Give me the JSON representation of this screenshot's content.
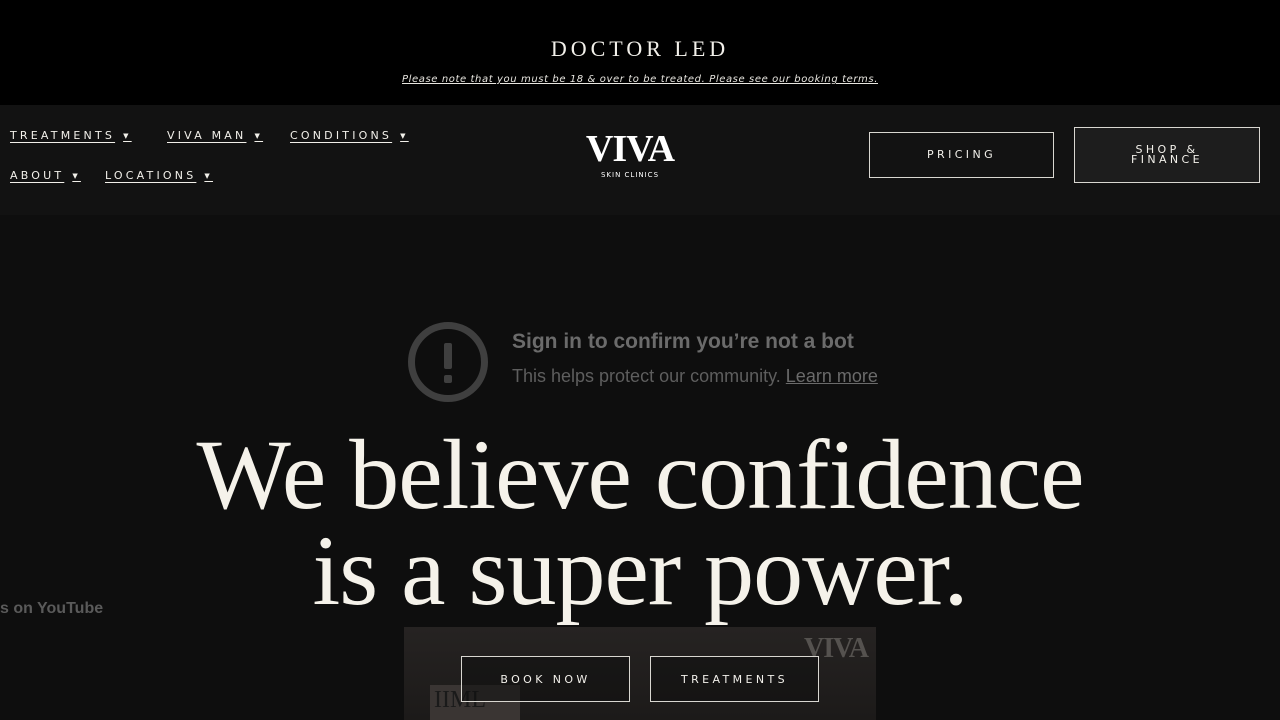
{
  "topbar": {
    "title": "DOCTOR LED",
    "notice": "Please note that you must be 18 & over to be treated. Please see our booking terms."
  },
  "nav": {
    "items": [
      {
        "label": "TREATMENTS"
      },
      {
        "label": "VIVA MAN"
      },
      {
        "label": "CONDITIONS"
      },
      {
        "label": "ABOUT"
      },
      {
        "label": "LOCATIONS"
      }
    ],
    "caret_icon": "caret-down-icon"
  },
  "logo": {
    "name": "VIVA",
    "tagline": "SKIN CLINICS"
  },
  "header_buttons": {
    "pricing": "PRICING",
    "shop_finance": "SHOP &\nFINANCE"
  },
  "video": {
    "bot_title": "Sign in to confirm you’re not a bot",
    "bot_sub": "This helps protect our community.",
    "learn_more": "Learn more",
    "youtube_label": "s on YouTube",
    "watermark": "VIVA",
    "plaque_text": "IIML"
  },
  "hero": {
    "line1": "We believe confidence",
    "line2": "is a super power.",
    "book_now": "BOOK NOW",
    "treatments": "TREATMENTS"
  },
  "colors": {
    "background": "#0f0f0f",
    "topbar": "#000000",
    "header": "#121212",
    "headline_text": "#f5f2ea"
  }
}
